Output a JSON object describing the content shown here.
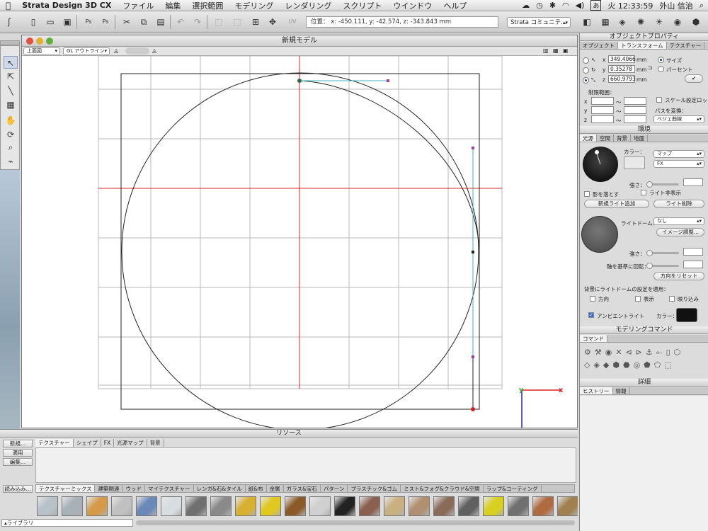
{
  "menubar": {
    "app": "Strata Design 3D CX",
    "items": [
      "ファイル",
      "編集",
      "選択範囲",
      "モデリング",
      "レンダリング",
      "スクリプト",
      "ウインドウ",
      "ヘルプ"
    ],
    "clock": "火 12:33:59",
    "user": "外山 信治",
    "input_indicator": "あ"
  },
  "toolbar": {
    "position_readout": "位置： x: -450.111, y: -42.574, z: -343.843 mm",
    "community_dropdown": "Strata コミュニテ..."
  },
  "document": {
    "title": "新規モデル",
    "view_select": "上面図",
    "render_select": "GL アウトライン"
  },
  "object_properties": {
    "title": "オブジェクトプロパティ",
    "tabs": [
      "オブジェクト",
      "トランスフォーム",
      "テクスチャー"
    ],
    "active_tab": "トランスフォーム",
    "x_value": "349.4066",
    "y_value": "0.35278",
    "z_value": "660.9793",
    "unit": "mm",
    "size_label": "サイズ",
    "percent_label": "パーセント",
    "limit_label": "制限範囲：",
    "axis_x": "x",
    "axis_y": "y",
    "axis_z": "z",
    "tilde": "～",
    "scale_lock_label": "スケール設定ロック",
    "path_convert_label": "パスを変換：",
    "path_convert_value": "ベジェ曲線"
  },
  "environment": {
    "title": "環境",
    "tabs": [
      "光源",
      "空間",
      "背景",
      "地面"
    ],
    "active_tab": "光源",
    "color_label": "カラー：",
    "map_select": "マップ",
    "fx_select": "FX",
    "intensity_label": "強さ：",
    "cast_shadow_label": "影を落とす",
    "hide_light_label": "ライト非表示",
    "add_light_button": "新規ライト追加",
    "delete_light_button": "ライト削除",
    "light_dome_label": "ライトドーム：",
    "light_dome_value": "なし",
    "image_adjust_button": "イメージ調整...",
    "intensity2_label": "強さ：",
    "rotate_axis_label": "軸を基準に回転：",
    "reset_direction_button": "方向をリセット",
    "apply_bg_label": "背景にライトドームの設定を適用：",
    "direction_label": "方向",
    "display_label": "表示",
    "reflection_label": "映り込み",
    "ambient_light_label": "アンビエントライト",
    "ambient_color_label": "カラー：",
    "ambient_checked": true
  },
  "modeling_commands": {
    "title": "モデリングコマンド",
    "tab": "コマンド"
  },
  "details": {
    "title": "詳細",
    "tabs": [
      "ヒストリー",
      "情報"
    ]
  },
  "resources": {
    "title": "リソース",
    "tabs": [
      "テクスチャー",
      "シェイプ",
      "FX",
      "光源マップ",
      "背景"
    ],
    "side_buttons": [
      "新規...",
      "適用",
      "編集..."
    ],
    "load_button": "読み込み...",
    "library_label": "▴ライブラリ",
    "categories": [
      "テクスチャーミックス",
      "建築関連",
      "ウッド",
      "マイテクスチャー",
      "レンガ&石&タイル",
      "紙&布",
      "金属",
      "ガラス&宝石",
      "パターン",
      "プラスチック&ゴム",
      "ミスト&フォグ&クラウド&空間",
      "ラップ&コーティング"
    ],
    "swatch_colors": [
      "#b8c0c8",
      "#a8b0b8",
      "#d49a4a",
      "#c0c0c0",
      "#6a88b8",
      "#d8dde2",
      "#707070",
      "#8a8a8a",
      "#d8b030",
      "#e0c820",
      "#8a5a28",
      "#d0d0d0",
      "#222222",
      "#8a6050",
      "#c8b080",
      "#b09070",
      "#8a6a58",
      "#606060",
      "#d8d020",
      "#707070",
      "#b06a40",
      "#a08050"
    ]
  },
  "colors": {
    "axis_red": "#e02020",
    "axis_green": "#20b020",
    "axis_blue": "#2020e0",
    "handle_cyan": "#40b0c0",
    "panel_bg": "#dcdcdc"
  }
}
